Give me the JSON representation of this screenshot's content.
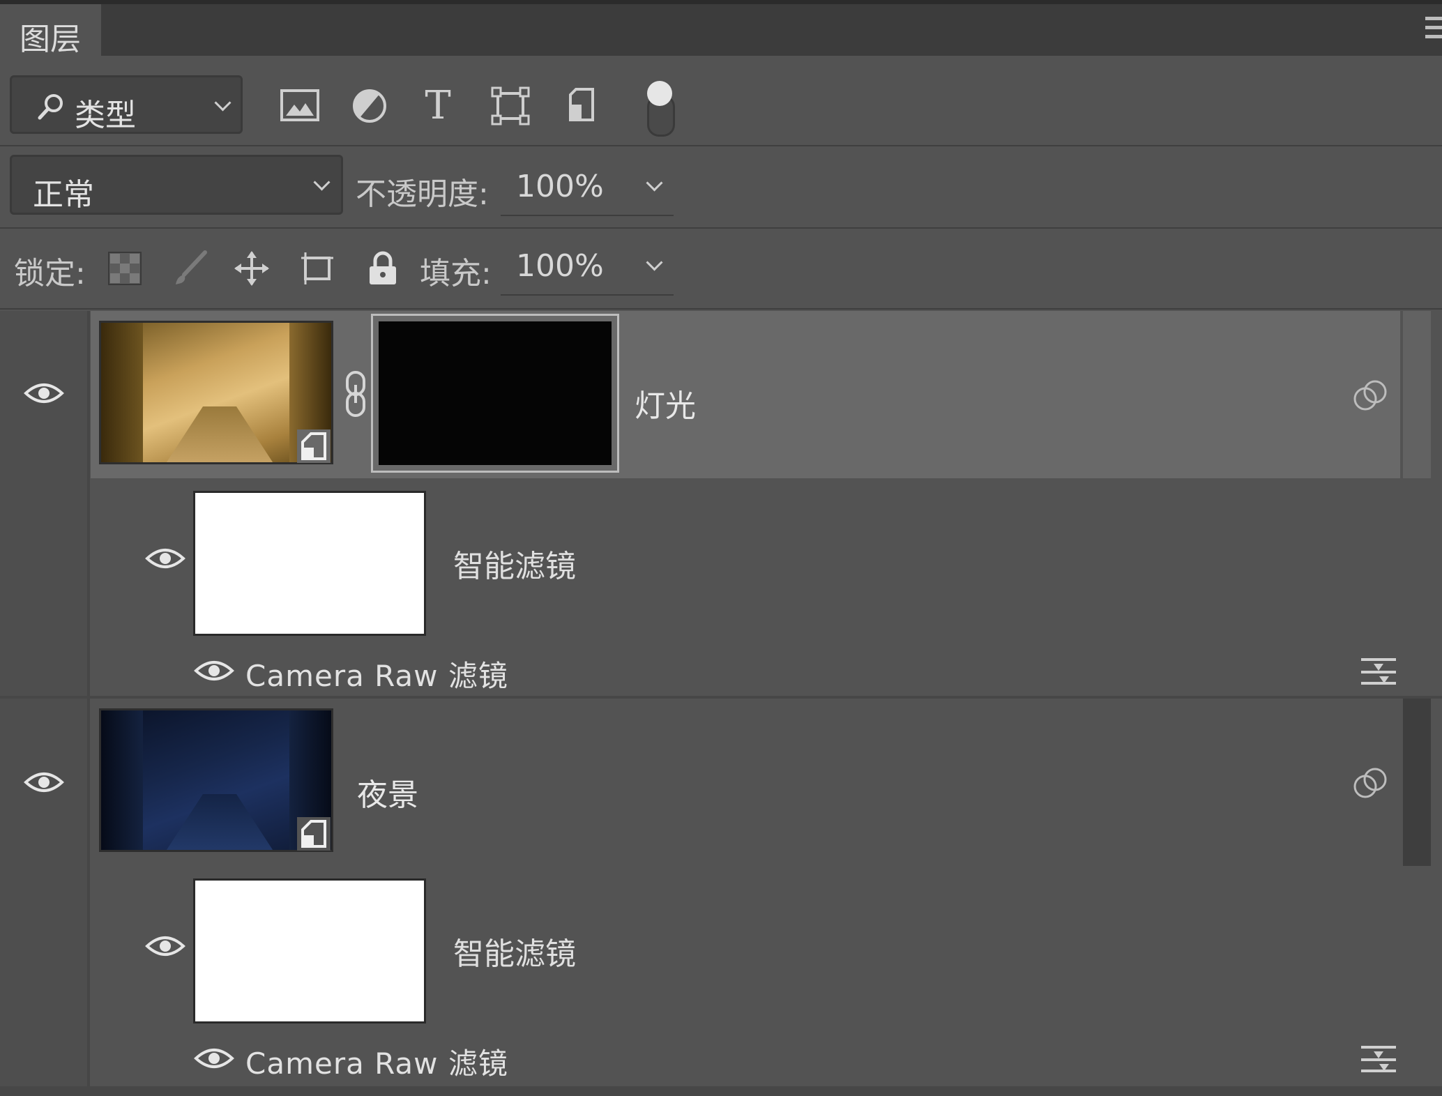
{
  "panel": {
    "title": "图层"
  },
  "filter": {
    "kind_label": "类型",
    "icons": [
      "pixel-filter-icon",
      "adjustment-filter-icon",
      "type-filter-icon",
      "shape-filter-icon",
      "smart-object-filter-icon"
    ],
    "type_glyph": "T"
  },
  "blend": {
    "mode": "正常",
    "opacity_label": "不透明度:",
    "opacity_value": "100%"
  },
  "lock": {
    "label": "锁定:",
    "fill_label": "填充:",
    "fill_value": "100%"
  },
  "layers": [
    {
      "name": "灯光",
      "visible": true,
      "selected": true,
      "has_mask": true,
      "smart_filters_label": "智能滤镜",
      "filter_name": "Camera Raw 滤镜"
    },
    {
      "name": "夜景",
      "visible": true,
      "selected": false,
      "has_mask": false,
      "smart_filters_label": "智能滤镜",
      "filter_name": "Camera Raw 滤镜"
    }
  ],
  "colors": {
    "panel_bg": "#535353",
    "selected_row": "#696969",
    "tabbar_bg": "#3c3c3c",
    "warm_thumb": "#c9a15a",
    "night_thumb": "#14233f"
  }
}
